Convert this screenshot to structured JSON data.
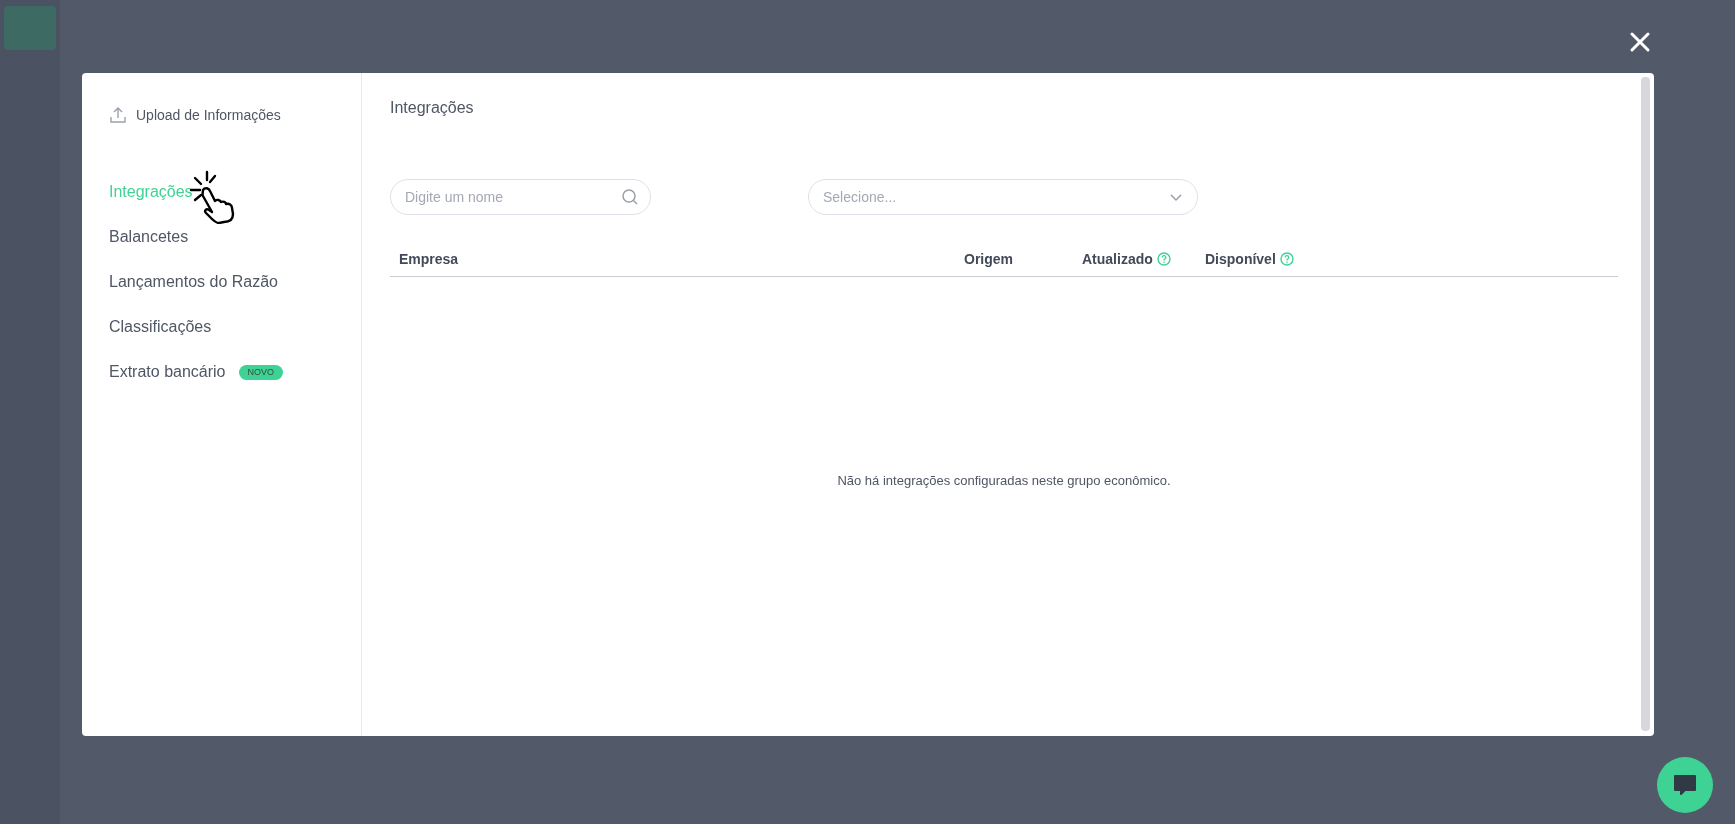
{
  "upload": {
    "label": "Upload de Informações"
  },
  "nav": [
    {
      "label": "Integrações",
      "selected": true
    },
    {
      "label": "Balancetes",
      "selected": false
    },
    {
      "label": "Lançamentos do Razão",
      "selected": false
    },
    {
      "label": "Classificações",
      "selected": false
    },
    {
      "label": "Extrato bancário",
      "selected": false,
      "badge": "NOVO"
    }
  ],
  "content": {
    "title": "Integrações",
    "search": {
      "placeholder": "Digite um nome"
    },
    "select": {
      "placeholder": "Selecione..."
    },
    "table": {
      "columns": [
        {
          "label": "Empresa",
          "help": false
        },
        {
          "label": "Origem",
          "help": false
        },
        {
          "label": "Atualizado",
          "help": true
        },
        {
          "label": "Disponível",
          "help": true
        }
      ],
      "empty_message": "Não há integrações configuradas neste grupo econômico."
    }
  }
}
